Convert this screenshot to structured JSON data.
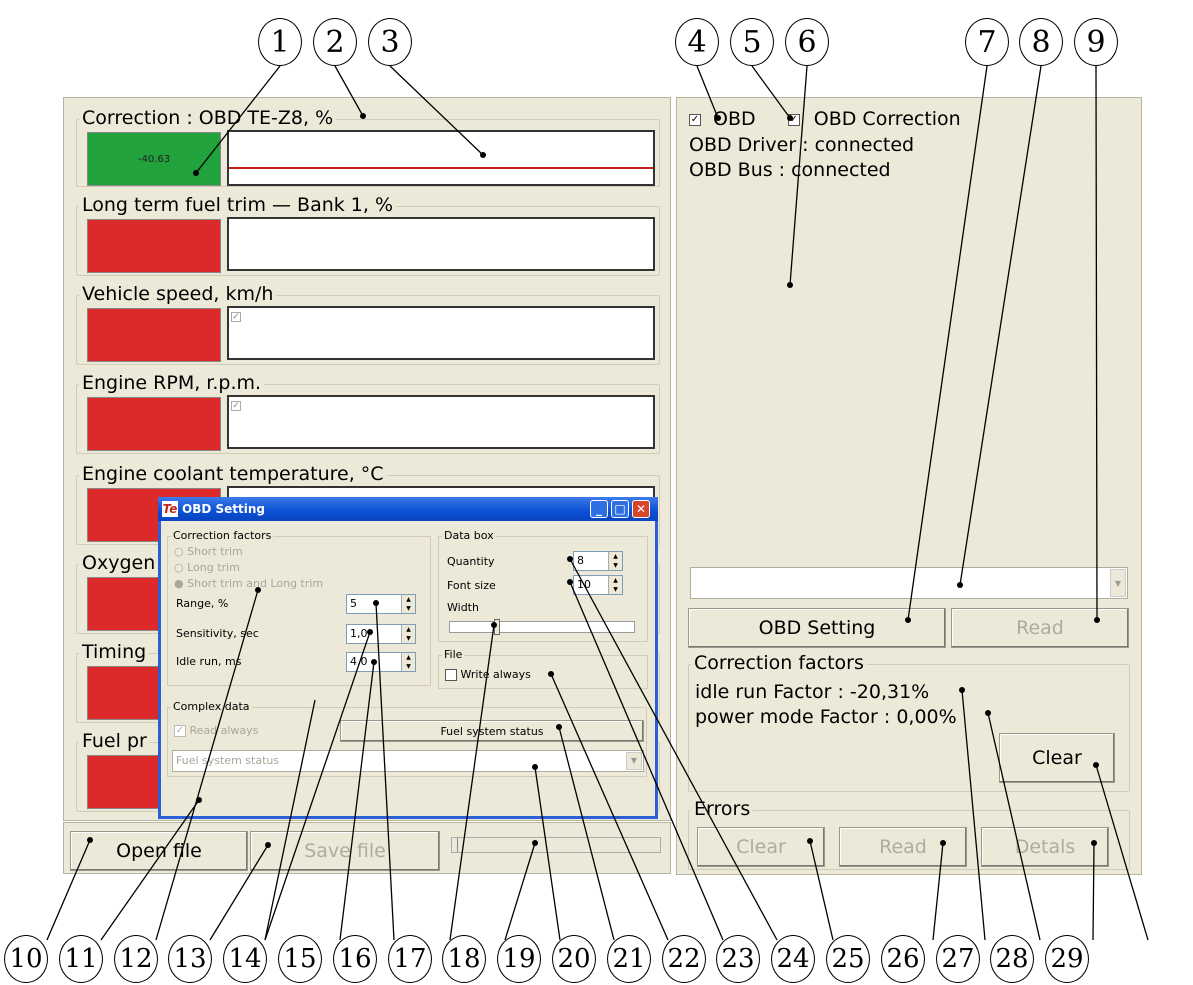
{
  "callouts": [
    "1",
    "2",
    "3",
    "4",
    "5",
    "6",
    "7",
    "8",
    "9",
    "10",
    "11",
    "12",
    "13",
    "14",
    "15",
    "16",
    "17",
    "18",
    "19",
    "20",
    "21",
    "22",
    "23",
    "24",
    "25",
    "26",
    "27",
    "28",
    "29"
  ],
  "left": {
    "groups": [
      {
        "title": "Correction : OBD TE-Z8, %",
        "value": "-40.63",
        "status": "green"
      },
      {
        "title": "Long term fuel trim — Bank 1, %",
        "value": "",
        "status": "red"
      },
      {
        "title": "Vehicle speed, km/h",
        "value": "",
        "status": "red"
      },
      {
        "title": "Engine RPM, r.p.m.",
        "value": "",
        "status": "red"
      },
      {
        "title": "Engine coolant temperature, °C",
        "value": "",
        "status": "red"
      },
      {
        "title": "Oxygen",
        "value": "",
        "status": "red"
      },
      {
        "title": "Timing",
        "value": "",
        "status": "red"
      },
      {
        "title": "Fuel pr",
        "value": "",
        "status": "red"
      }
    ],
    "open_file": "Open file",
    "save_file": "Save file"
  },
  "right": {
    "obd_label": "OBD",
    "obd_correction_label": "OBD Correction",
    "driver_status": "OBD Driver : connected",
    "bus_status": "OBD Bus : connected",
    "obd_setting_button": "OBD Setting",
    "read_button": "Read",
    "correction_factors": {
      "title": "Correction factors",
      "idle_run": "idle run Factor : -20,31%",
      "power_mode": "power mode Factor : 0,00%",
      "clear": "Clear"
    },
    "errors": {
      "title": "Errors",
      "clear": "Clear",
      "read": "Read",
      "details": "Detals"
    }
  },
  "dialog": {
    "title": "OBD Setting",
    "icon_text": "Te",
    "correction_factors": {
      "title": "Correction factors",
      "options": [
        "Short trim",
        "Long trim",
        "Short trim and Long trim"
      ],
      "range_label": "Range, %",
      "range_value": "5",
      "sensitivity_label": "Sensitivity, sec",
      "sensitivity_value": "1,0",
      "idle_label": "Idle run, ms",
      "idle_value": "4,0"
    },
    "data_box": {
      "title": "Data box",
      "quantity_label": "Quantity",
      "quantity_value": "8",
      "font_label": "Font size",
      "font_value": "10",
      "width_label": "Width"
    },
    "file": {
      "title": "File",
      "write_always": "Write always"
    },
    "complex_data": {
      "title": "Complex data",
      "read_always": "Read always",
      "fuel_button": "Fuel system status",
      "fuel_combo": "Fuel system status"
    }
  }
}
